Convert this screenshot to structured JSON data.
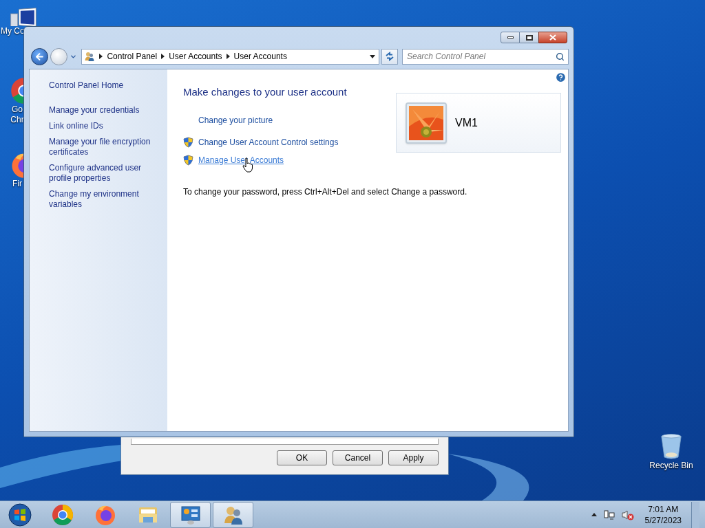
{
  "desktop_icons": [
    {
      "kind": "computer",
      "lines": [
        "My Co"
      ]
    },
    {
      "kind": "chrome",
      "lines": [
        "Go",
        "Chr"
      ]
    },
    {
      "kind": "firefox",
      "lines": [
        "Fir"
      ]
    },
    {
      "kind": "recycle",
      "lines": [
        "Recycle Bin"
      ]
    }
  ],
  "dialog": {
    "buttons": [
      "OK",
      "Cancel",
      "Apply"
    ]
  },
  "window": {
    "breadcrumb": [
      "Control Panel",
      "User Accounts",
      "User Accounts"
    ],
    "search": {
      "placeholder": "Search Control Panel"
    },
    "sidebar": {
      "items": [
        {
          "label": "Control Panel Home",
          "kind": "home"
        },
        {
          "label": "Manage your credentials",
          "kind": "task"
        },
        {
          "label": "Link online IDs",
          "kind": "task"
        },
        {
          "label": "Manage your file encryption certificates",
          "kind": "task"
        },
        {
          "label": "Configure advanced user profile properties",
          "kind": "task"
        },
        {
          "label": "Change my environment variables",
          "kind": "task"
        }
      ]
    },
    "heading": "Make changes to your user account",
    "tasks": [
      {
        "label": "Change your picture",
        "shield": false,
        "hovered": false
      },
      {
        "label": "Change User Account Control settings",
        "shield": true,
        "hovered": false
      },
      {
        "label": "Manage User Accounts",
        "shield": true,
        "hovered": true
      }
    ],
    "account": {
      "name": "VM1"
    },
    "note": "To change your password, press Ctrl+Alt+Del and select Change a password."
  },
  "taskbar": {
    "apps": [
      {
        "kind": "chrome",
        "open": false
      },
      {
        "kind": "firefox",
        "open": false
      },
      {
        "kind": "explorer",
        "open": false
      },
      {
        "kind": "control-panel",
        "open": true
      },
      {
        "kind": "users",
        "open": true
      }
    ],
    "clock": {
      "time": "7:01 AM",
      "date": "5/27/2023"
    }
  }
}
